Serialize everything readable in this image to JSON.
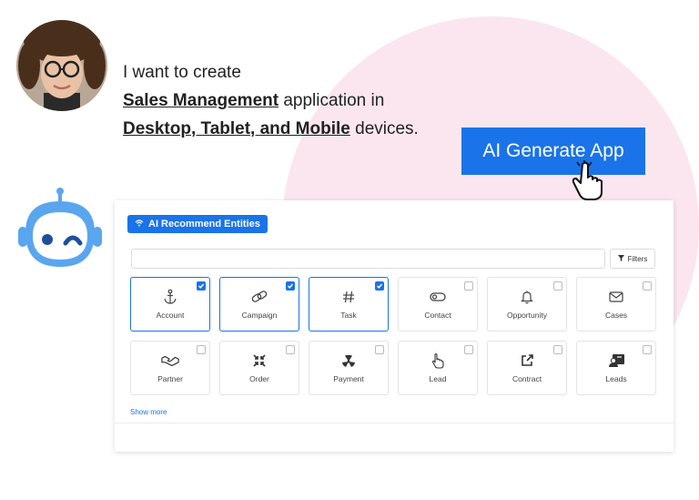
{
  "prompt": {
    "line1": "I want to create",
    "entity_highlight": "Sales Management",
    "line2_rest": " application in",
    "devices_highlight": "Desktop, Tablet, and Mobile",
    "line3_rest": " devices."
  },
  "generate_button": {
    "label": "AI Generate App"
  },
  "panel": {
    "recommend_label": "AI Recommend Entities",
    "search_placeholder": "",
    "filters_label": "Filters",
    "show_more_label": "Show more",
    "entities": [
      {
        "label": "Account",
        "icon": "anchor-icon",
        "selected": true
      },
      {
        "label": "Campaign",
        "icon": "link-icon",
        "selected": true
      },
      {
        "label": "Task",
        "icon": "hash-icon",
        "selected": true
      },
      {
        "label": "Contact",
        "icon": "toggle-icon",
        "selected": false
      },
      {
        "label": "Opportunity",
        "icon": "bell-icon",
        "selected": false
      },
      {
        "label": "Cases",
        "icon": "mail-icon",
        "selected": false
      },
      {
        "label": "Partner",
        "icon": "handshake-icon",
        "selected": false
      },
      {
        "label": "Order",
        "icon": "compress-icon",
        "selected": false
      },
      {
        "label": "Payment",
        "icon": "radiation-icon",
        "selected": false
      },
      {
        "label": "Lead",
        "icon": "hand-pointer-icon",
        "selected": false
      },
      {
        "label": "Contract",
        "icon": "external-link-icon",
        "selected": false
      },
      {
        "label": "Leads",
        "icon": "contact-card-icon",
        "selected": false
      }
    ]
  },
  "colors": {
    "accent": "#1a73e8",
    "background_circle": "#fbe6ef",
    "robot": "#5aa6ee"
  }
}
